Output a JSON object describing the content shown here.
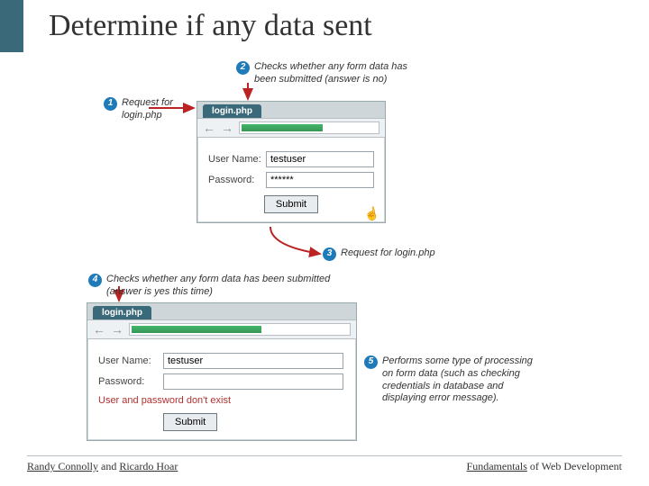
{
  "title": "Determine if any data sent",
  "annotations": {
    "a1": "Request for login.php",
    "a2": "Checks whether any form data has been submitted (answer is no)",
    "a3": "Request for login.php",
    "a4": "Checks whether any form data has been submitted (answer is yes this time)",
    "a5": "Performs some type of processing on form data (such as checking credentials in database and displaying error message)."
  },
  "bubbles": {
    "b1": "1",
    "b2": "2",
    "b3": "3",
    "b4": "4",
    "b5": "5"
  },
  "browser1": {
    "tab": "login.php",
    "labels": {
      "user": "User Name:",
      "pass": "Password:"
    },
    "values": {
      "user": "testuser",
      "pass": "******"
    },
    "submit": "Submit"
  },
  "browser2": {
    "tab": "login.php",
    "labels": {
      "user": "User Name:",
      "pass": "Password:"
    },
    "values": {
      "user": "testuser",
      "pass": ""
    },
    "error": "User and password don't exist",
    "submit": "Submit"
  },
  "footer": {
    "left_u1": "Randy Connolly",
    "left_mid": " and ",
    "left_u2": "Ricardo Hoar",
    "right_u": "Fundamentals",
    "right_rest": " of Web Development"
  }
}
